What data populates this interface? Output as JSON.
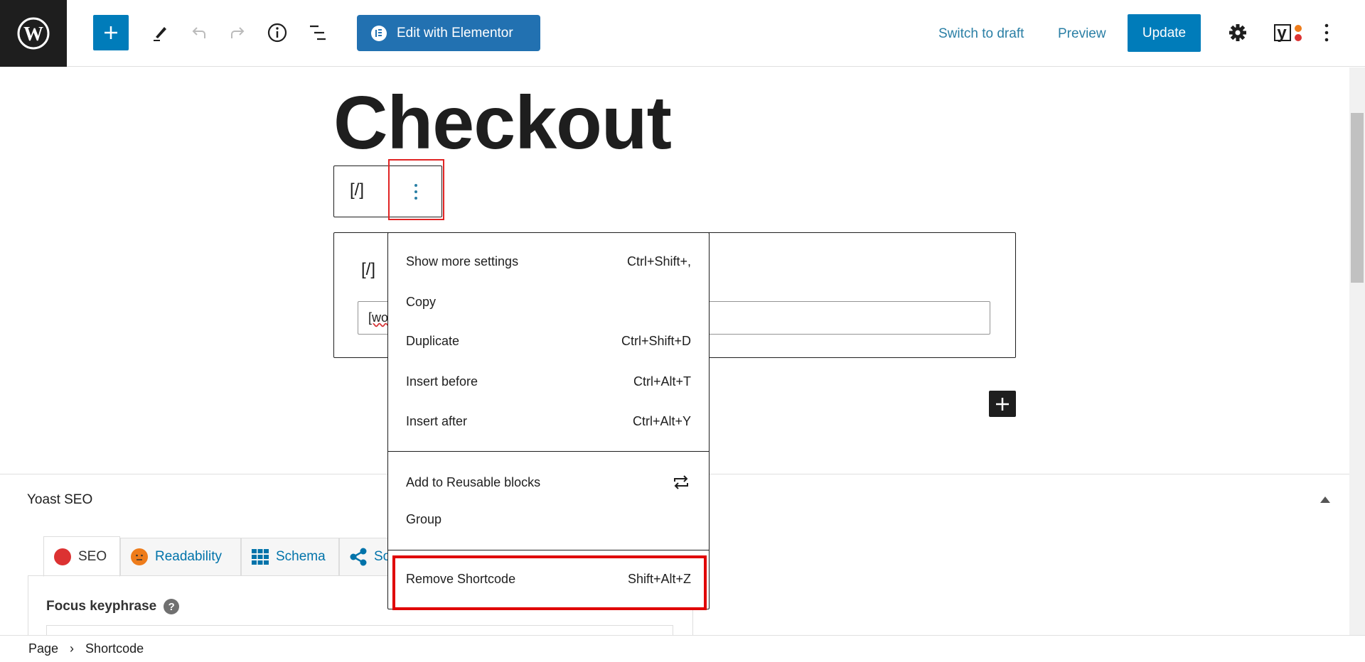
{
  "topbar": {
    "elementor_label": "Edit with Elementor",
    "switch_draft": "Switch to draft",
    "preview": "Preview",
    "update": "Update"
  },
  "page": {
    "title": "Checkout",
    "block_icon": "[/]",
    "shortcode_value": "[wo"
  },
  "block_menu": {
    "items": [
      {
        "label": "Show more settings",
        "shortcut": "Ctrl+Shift+,"
      },
      {
        "label": "Copy",
        "shortcut": ""
      },
      {
        "label": "Duplicate",
        "shortcut": "Ctrl+Shift+D"
      },
      {
        "label": "Insert before",
        "shortcut": "Ctrl+Alt+T"
      },
      {
        "label": "Insert after",
        "shortcut": "Ctrl+Alt+Y"
      },
      {
        "label": "Add to Reusable blocks",
        "shortcut": ""
      },
      {
        "label": "Group",
        "shortcut": ""
      },
      {
        "label": "Remove Shortcode",
        "shortcut": "Shift+Alt+Z"
      }
    ]
  },
  "yoast": {
    "title": "Yoast SEO",
    "tabs": [
      {
        "label": "SEO"
      },
      {
        "label": "Readability"
      },
      {
        "label": "Schema"
      },
      {
        "label": "So"
      }
    ],
    "focus_keyphrase": "Focus keyphrase",
    "help": "?"
  },
  "breadcrumb": {
    "items": [
      "Page",
      "Shortcode"
    ],
    "separator": "›"
  },
  "colors": {
    "accent": "#007cba",
    "elementor": "#2271b1",
    "highlight": "#e00000",
    "seo_status": "#dc3232",
    "readability_status": "#ee7c1b"
  }
}
